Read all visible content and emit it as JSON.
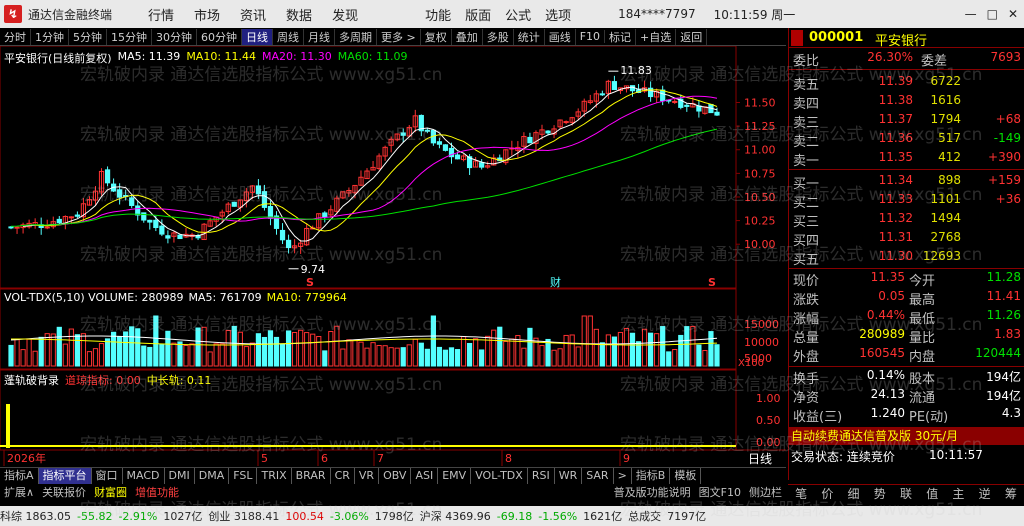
{
  "titlebar": {
    "app_title": "通达信金融终端",
    "menu": [
      "行情",
      "市场",
      "资讯",
      "数据",
      "发现"
    ],
    "menu2": [
      "功能",
      "版面",
      "公式",
      "选项"
    ],
    "account": "184****7797",
    "clock": "10:11:59 周一",
    "win": [
      "—",
      "□",
      "✕"
    ]
  },
  "toolbar": {
    "items": [
      "分时",
      "1分钟",
      "5分钟",
      "15分钟",
      "30分钟",
      "60分钟",
      "日线",
      "周线",
      "月线",
      "多周期",
      "更多 >",
      "复权",
      "叠加",
      "多股",
      "统计",
      "画线",
      "F10",
      "标记",
      "+自选",
      "返回"
    ],
    "active": "日线"
  },
  "chart": {
    "header": "平安银行(日线前复权)",
    "ma5_label": "MA5: 11.39",
    "ma10_label": "MA10: 11.44",
    "ma20_label": "MA20: 11.30",
    "ma60_label": "MA60: 11.09",
    "price_ticks": [
      "11.50",
      "11.25",
      "11.00",
      "10.75",
      "10.50",
      "10.25",
      "10.00"
    ],
    "high_marker": "11.83",
    "low_marker": "9.74",
    "vol_header": "VOL-TDX(5,10) VOLUME: 280989",
    "vol_ma5": "MA5: 761709",
    "vol_ma10": "MA10: 779964",
    "vol_ticks": [
      "15000",
      "10000",
      "5000"
    ],
    "vol_unit": "X100",
    "ind_header": "蓬轨破背录",
    "ind_a": "道琼指标: 0.00",
    "ind_b": "中长轨: 0.11",
    "ind_ticks": [
      "1.00",
      "0.50",
      "0.00"
    ],
    "x_labels": [
      "2026年",
      "5",
      "6",
      "7",
      "8",
      "9"
    ],
    "x_period": "日线",
    "s_marks": [
      "S",
      "S"
    ],
    "cai_mark": "财"
  },
  "rightpanel": {
    "code": "000001",
    "name": "平安银行",
    "weibi_label": "委比",
    "weibi": "26.30%",
    "weicha_label": "委差",
    "weicha": "7693",
    "asks": [
      {
        "label": "卖五",
        "price": "11.39",
        "vol": "6722",
        "delta": ""
      },
      {
        "label": "卖四",
        "price": "11.38",
        "vol": "1616",
        "delta": ""
      },
      {
        "label": "卖三",
        "price": "11.37",
        "vol": "1794",
        "delta": "+68"
      },
      {
        "label": "卖二",
        "price": "11.36",
        "vol": "517",
        "delta": "-149"
      },
      {
        "label": "卖一",
        "price": "11.35",
        "vol": "412",
        "delta": "+390"
      }
    ],
    "bids": [
      {
        "label": "买一",
        "price": "11.34",
        "vol": "898",
        "delta": "+159"
      },
      {
        "label": "买二",
        "price": "11.33",
        "vol": "1101",
        "delta": "+36"
      },
      {
        "label": "买三",
        "price": "11.32",
        "vol": "1494",
        "delta": ""
      },
      {
        "label": "买四",
        "price": "11.31",
        "vol": "2768",
        "delta": ""
      },
      {
        "label": "买五",
        "price": "11.30",
        "vol": "12693",
        "delta": ""
      }
    ],
    "stats": [
      {
        "l1": "现价",
        "v1": "11.35",
        "c1": "red",
        "l2": "今开",
        "v2": "11.28",
        "c2": "green"
      },
      {
        "l1": "涨跌",
        "v1": "0.05",
        "c1": "red",
        "l2": "最高",
        "v2": "11.41",
        "c2": "red"
      },
      {
        "l1": "涨幅",
        "v1": "0.44%",
        "c1": "red",
        "l2": "最低",
        "v2": "11.26",
        "c2": "green"
      },
      {
        "l1": "总量",
        "v1": "280989",
        "c1": "yellow",
        "l2": "量比",
        "v2": "1.83",
        "c2": "red"
      },
      {
        "l1": "外盘",
        "v1": "160545",
        "c1": "red",
        "l2": "内盘",
        "v2": "120444",
        "c2": "green"
      }
    ],
    "stats2": [
      {
        "l1": "换手",
        "v1": "0.14%",
        "l2": "股本",
        "v2": "194亿"
      },
      {
        "l1": "净资",
        "v1": "24.13",
        "l2": "流通",
        "v2": "194亿"
      },
      {
        "l1": "收益(三)",
        "v1": "1.240",
        "l2": "PE(动)",
        "v2": "4.3"
      }
    ],
    "promo": "自动续费通达信普及版 30元/月",
    "trade_status_label": "交易状态: 连续竞价",
    "trade_time": "10:11:57",
    "bottom_tabs": [
      "笔",
      "价",
      "细",
      "势",
      "联",
      "值",
      "主",
      "逆",
      "筹"
    ]
  },
  "tabbar1": {
    "items": [
      "指标A",
      "指标平台",
      "窗口",
      "MACD",
      "DMI",
      "DMA",
      "FSL",
      "TRIX",
      "BRAR",
      "CR",
      "VR",
      "OBV",
      "ASI",
      "EMV",
      "VOL-TDX",
      "RSI",
      "WR",
      "SAR",
      ">",
      "指标B",
      "模板"
    ],
    "active": "指标平台"
  },
  "tabbar2": {
    "items": [
      "扩展∧",
      "关联报价",
      "财富圈",
      "增值功能"
    ],
    "right": [
      "普及版功能说明",
      "图文F10",
      "侧边栏"
    ]
  },
  "statusbar": {
    "items": [
      {
        "t": "科综 1863.05",
        "c": "#222"
      },
      {
        "t": "-55.82",
        "c": "#0a0"
      },
      {
        "t": "-2.91%",
        "c": "#0a0"
      },
      {
        "t": "1027亿",
        "c": "#222"
      },
      {
        "t": "创业 3188.41",
        "c": "#222"
      },
      {
        "t": "100.54",
        "c": "#d00"
      },
      {
        "t": "-3.06%",
        "c": "#0a0"
      },
      {
        "t": "1798亿",
        "c": "#222"
      },
      {
        "t": "沪深 4369.96",
        "c": "#222"
      },
      {
        "t": "-69.18",
        "c": "#0a0"
      },
      {
        "t": "-1.56%",
        "c": "#0a0"
      },
      {
        "t": "1621亿",
        "c": "#222"
      },
      {
        "t": "总成交",
        "c": "#222"
      },
      {
        "t": "7197亿",
        "c": "#222"
      }
    ]
  },
  "watermark": "宏轨破内录 通达信选股指标公式 www.xg51.cn",
  "chart_data": {
    "type": "candlestick",
    "title": "平安银行(日线前复权)",
    "ylim": [
      9.6,
      11.95
    ],
    "series": [
      {
        "name": "MA5",
        "value": 11.39
      },
      {
        "name": "MA10",
        "value": 11.44
      },
      {
        "name": "MA20",
        "value": 11.3
      },
      {
        "name": "MA60",
        "value": 11.09
      }
    ],
    "high": 11.83,
    "low": 9.74
  }
}
